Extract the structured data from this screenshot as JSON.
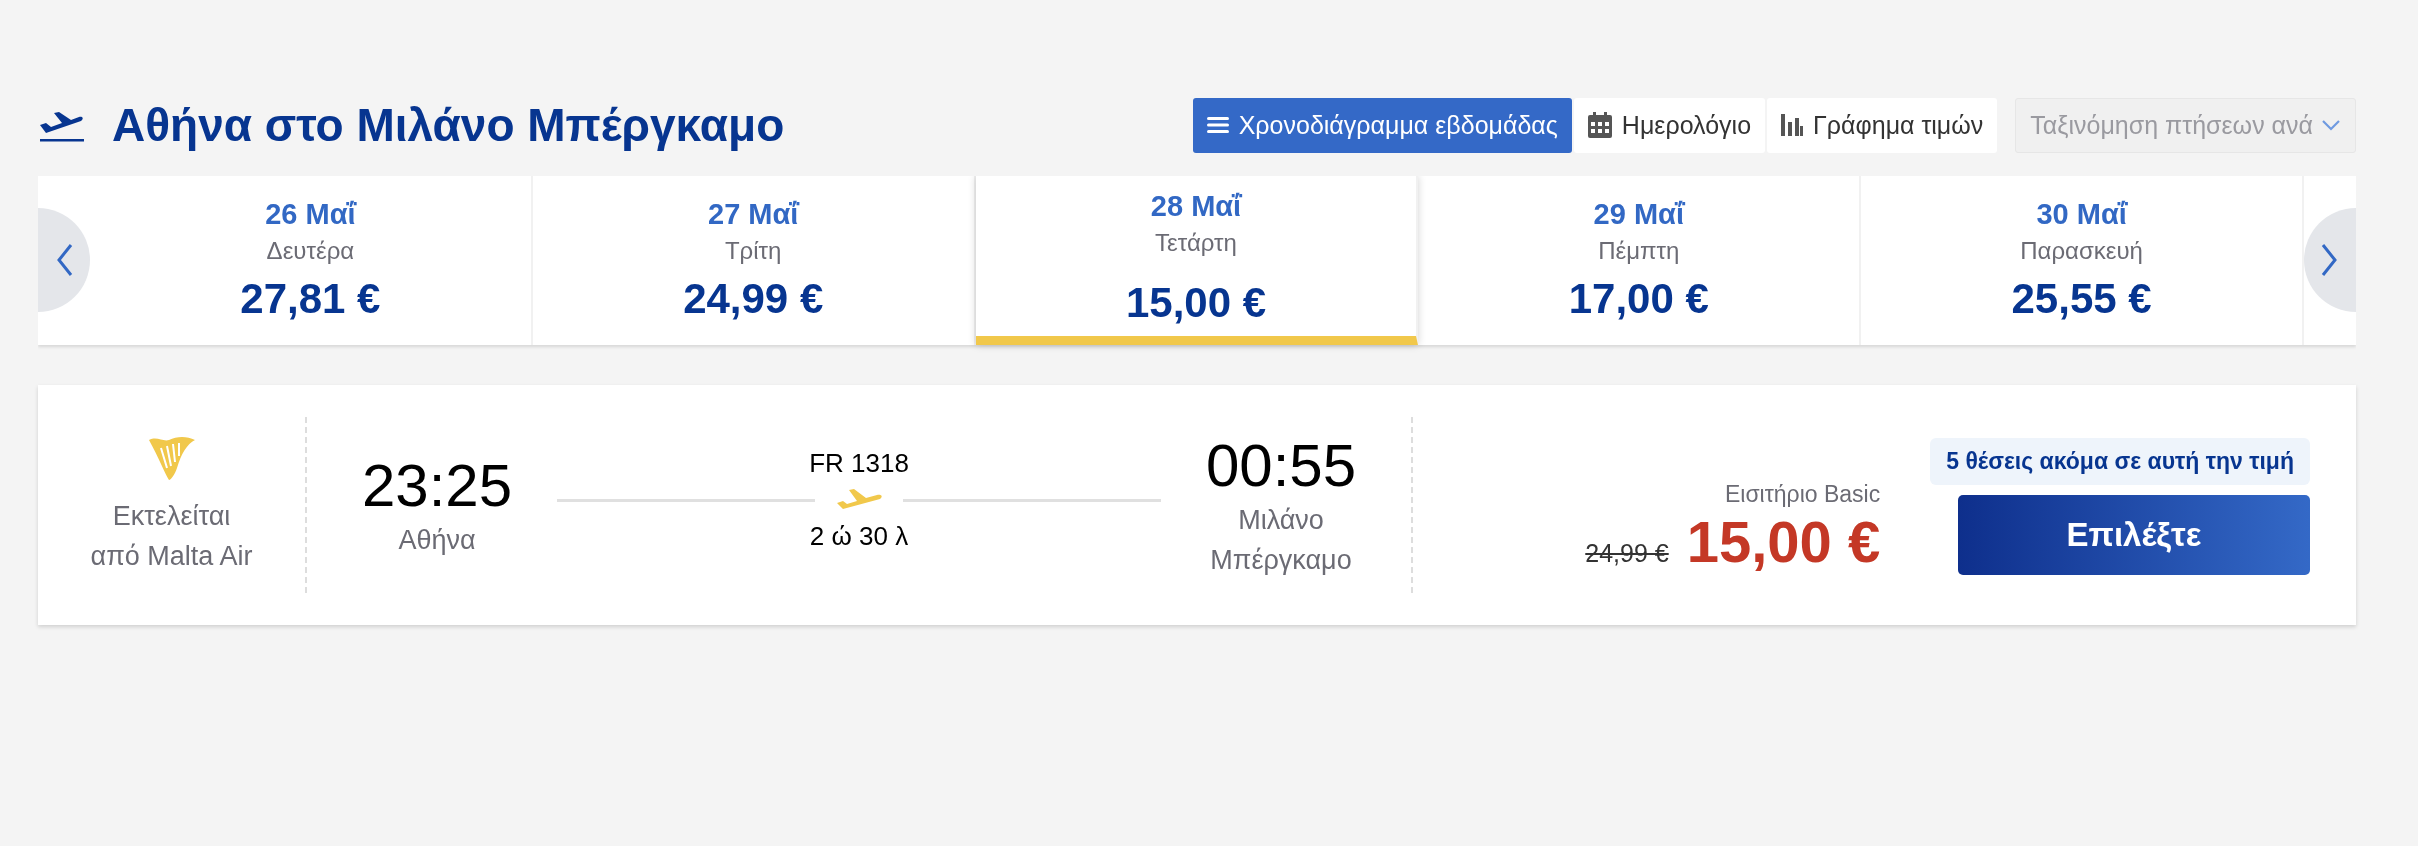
{
  "title": "Αθήνα στο Μιλάνο Μπέργκαμο",
  "views": [
    {
      "label": "Χρονοδιάγραμμα εβδομάδας",
      "kind": "list",
      "selected": true
    },
    {
      "label": "Ημερολόγιο",
      "kind": "calendar",
      "selected": false
    },
    {
      "label": "Γράφημα τιμών",
      "kind": "chart",
      "selected": false
    }
  ],
  "sort": {
    "placeholder": "Ταξινόμηση πτήσεων ανά"
  },
  "dates": [
    {
      "date": "26 Μαΐ",
      "day": "Δευτέρα",
      "price": "27,81 €",
      "selected": false
    },
    {
      "date": "27 Μαΐ",
      "day": "Τρίτη",
      "price": "24,99 €",
      "selected": false
    },
    {
      "date": "28 Μαΐ",
      "day": "Τετάρτη",
      "price": "15,00 €",
      "selected": true
    },
    {
      "date": "29 Μαΐ",
      "day": "Πέμπτη",
      "price": "17,00 €",
      "selected": false
    },
    {
      "date": "30 Μαΐ",
      "day": "Παρασκευή",
      "price": "25,55 €",
      "selected": false
    }
  ],
  "flight": {
    "operator": "Εκτελείται από Malta Air",
    "departure_time": "23:25",
    "departure_city": "Αθήνα",
    "flight_number": "FR 1318",
    "duration": "2 ώ 30 λ",
    "arrival_time": "00:55",
    "arrival_city": "Μιλάνο Μπέργκαμο",
    "fare_name": "Εισιτήριο Basic",
    "old_price": "24,99 €",
    "price": "15,00 €",
    "seats_notice": "5 θέσεις ακόμα σε αυτή την τιμή",
    "button": "Επιλέξτε"
  }
}
